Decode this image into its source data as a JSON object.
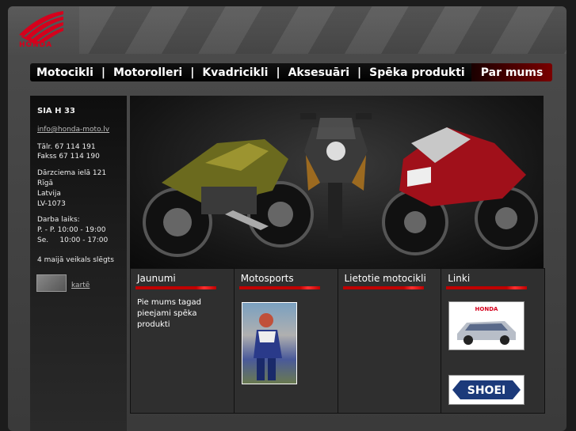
{
  "brand": {
    "name": "HONDA",
    "color": "#d5001c"
  },
  "nav": {
    "items": [
      "Motocikli",
      "Motorolleri",
      "Kvadricikli",
      "Aksesuāri",
      "Spēka produkti"
    ],
    "separator": "|",
    "last": "Par mums"
  },
  "sidebar": {
    "company": "SIA H 33",
    "email": "info@honda-moto.lv",
    "phone": "Tālr. 67 114 191",
    "fax": "Fakss 67 114 190",
    "address1": "Dārzciema ielā 121",
    "address2": "Rīgā",
    "address3": "Latvija",
    "address4": "LV-1073",
    "hours_title": "Darba laiks:",
    "hours1": "P. - P. 10:00 - 19:00",
    "hours2": "Se.     10:00 - 17:00",
    "notice": "4 maijā veikals slēgts",
    "map_link": "kartē"
  },
  "columns": {
    "col1": {
      "title": "Jaunumi",
      "text": "Pie mums tagad pieejami spēka produkti"
    },
    "col2": {
      "title": "Motosports"
    },
    "col3": {
      "title": "Lietotie motocikli"
    },
    "col4": {
      "title": "Linki",
      "link1_brand": "HONDA",
      "link2_brand": "SHOEI"
    }
  },
  "colors": {
    "accent_red": "#c00000",
    "nav_bg": "#000000"
  }
}
